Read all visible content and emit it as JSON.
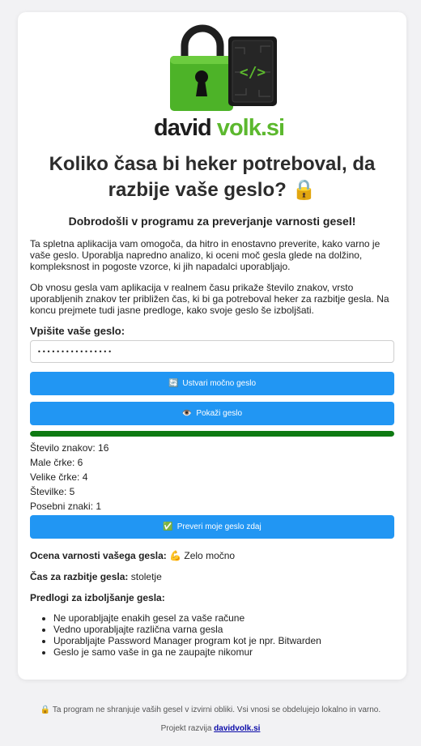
{
  "brand": {
    "name_dark": "david",
    "name_green": "volk.si"
  },
  "heading": {
    "line": "Koliko časa bi heker potreboval, da razbije vaše geslo?",
    "emoji": "🔒"
  },
  "welcome": "Dobrodošli v programu za preverjanje varnosti gesel!",
  "intro_1": "Ta spletna aplikacija vam omogoča, da hitro in enostavno preverite, kako varno je vaše geslo. Uporablja napredno analizo, ki oceni moč gesla glede na dolžino, kompleksnost in pogoste vzorce, ki jih napadalci uporabljajo.",
  "intro_2": "Ob vnosu gesla vam aplikacija v realnem času prikaže število znakov, vrsto uporabljenih znakov ter približen čas, ki bi ga potreboval heker za razbitje gesla. Na koncu prejmete tudi jasne predloge, kako svoje geslo še izboljšati.",
  "password": {
    "label": "Vpišite vaše geslo:",
    "value": "••••••••••••••••"
  },
  "buttons": {
    "generate": {
      "icon": "🔄",
      "label": "Ustvari močno geslo"
    },
    "show": {
      "icon": "👁️",
      "label": "Pokaži geslo"
    },
    "check": {
      "icon": "✅",
      "label": "Preveri moje geslo zdaj"
    }
  },
  "strength": {
    "fill_fraction": 1.0,
    "color": "#0e7a12"
  },
  "stats": {
    "chars": "Število znakov: 16",
    "lower": "Male črke: 6",
    "upper": "Velike črke: 4",
    "digits": "Številke: 5",
    "special": "Posebni znaki: 1"
  },
  "rating": {
    "label": "Ocena varnosti vašega gesla:",
    "emoji": "💪",
    "value": "Zelo močno"
  },
  "crack_time": {
    "label": "Čas za razbitje gesla:",
    "value": "stoletje"
  },
  "tips": {
    "title": "Predlogi za izboljšanje gesla:",
    "items": [
      "Ne uporabljajte enakih gesel za vaše račune",
      "Vedno uporabljajte različna varna gesla",
      "Uporabljajte Password Manager program kot je npr. Bitwarden",
      "Geslo je samo vaše in ga ne zaupajte nikomur"
    ]
  },
  "footer": {
    "lock_emoji": "🔒",
    "note": "Ta program ne shranjuje vaših gesel v izvirni obliki. Vsi vnosi se obdelujejo lokalno in varno.",
    "credit_prefix": "Projekt razvija",
    "credit_link": "davidvolk.si"
  },
  "colors": {
    "accent": "#2196f3",
    "brand_green": "#5cb82e",
    "strength_bar": "#0e7a12"
  }
}
